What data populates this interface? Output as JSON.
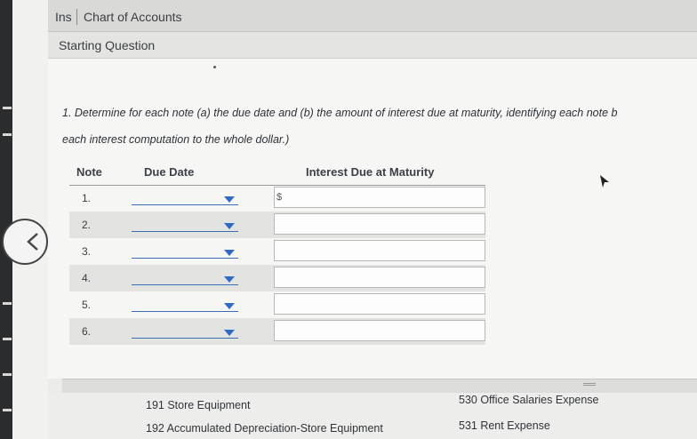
{
  "tabs": {
    "truncated_tab": "Ins",
    "active_tab": "Chart of Accounts"
  },
  "section": {
    "title": "Starting Question"
  },
  "question": {
    "line1": "1. Determine for each note (a) the due date and (b) the amount of interest due at maturity, identifying each note b",
    "line2": "each interest computation to the whole dollar.)"
  },
  "table": {
    "headers": {
      "note": "Note",
      "due_date": "Due Date",
      "interest": "Interest Due at Maturity"
    },
    "rows": [
      {
        "note": "1.",
        "due_date": "",
        "interest": "",
        "currency": "$"
      },
      {
        "note": "2.",
        "due_date": "",
        "interest": ""
      },
      {
        "note": "3.",
        "due_date": "",
        "interest": ""
      },
      {
        "note": "4.",
        "due_date": "",
        "interest": ""
      },
      {
        "note": "5.",
        "due_date": "",
        "interest": ""
      },
      {
        "note": "6.",
        "due_date": "",
        "interest": ""
      }
    ]
  },
  "accounts": {
    "left": [
      "191  Store Equipment",
      "192  Accumulated Depreciation-Store Equipment"
    ],
    "right": [
      "530  Office Salaries Expense",
      "531  Rent Expense"
    ]
  },
  "icons": {
    "back": "chevron-left-icon",
    "dropdown": "caret-down-icon",
    "cursor": "mouse-pointer-icon"
  },
  "colors": {
    "dropdown_accent": "#2f6bc4",
    "left_strip": "#2a2c2e"
  }
}
